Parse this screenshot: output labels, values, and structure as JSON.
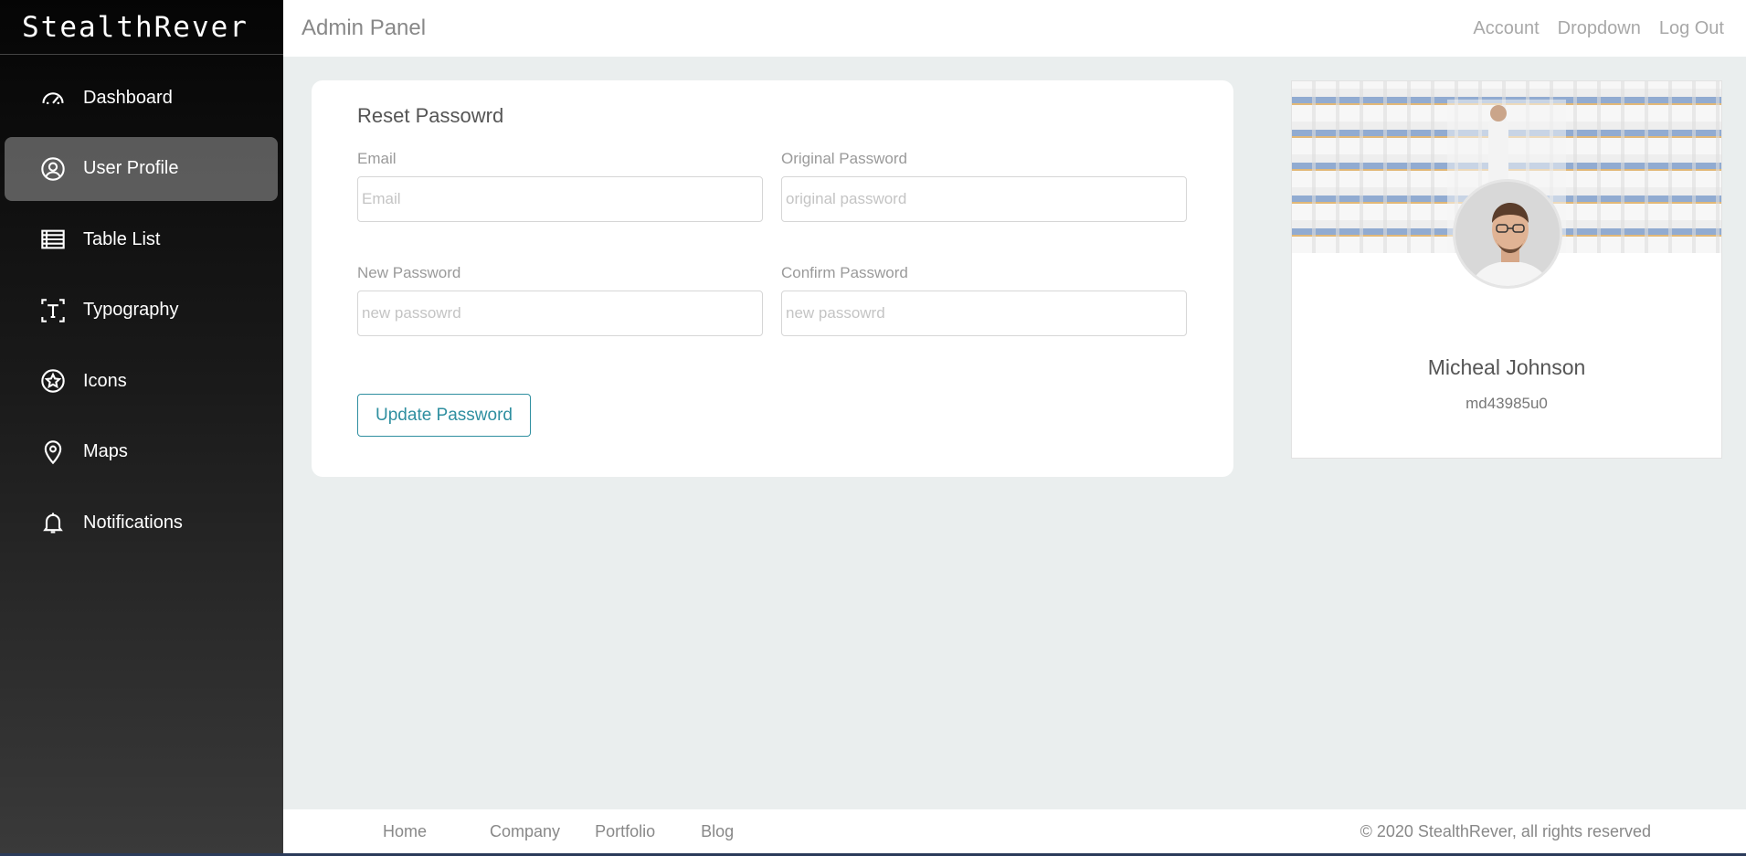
{
  "brand": "StealthRever",
  "sidebar": {
    "items": [
      {
        "label": "Dashboard",
        "icon": "speedometer-icon",
        "active": false
      },
      {
        "label": "User Profile",
        "icon": "user-circle-icon",
        "active": true
      },
      {
        "label": "Table List",
        "icon": "list-icon",
        "active": false
      },
      {
        "label": "Typography",
        "icon": "text-icon",
        "active": false
      },
      {
        "label": "Icons",
        "icon": "star-badge-icon",
        "active": false
      },
      {
        "label": "Maps",
        "icon": "map-pin-icon",
        "active": false
      },
      {
        "label": "Notifications",
        "icon": "bell-icon",
        "active": false
      }
    ]
  },
  "header": {
    "title": "Admin Panel",
    "links": [
      "Account",
      "Dropdown",
      "Log Out"
    ]
  },
  "form": {
    "title": "Reset Passowrd",
    "email": {
      "label": "Email",
      "placeholder": "Email",
      "value": ""
    },
    "original_password": {
      "label": "Original Password",
      "placeholder": "original password",
      "value": ""
    },
    "new_password": {
      "label": "New Password",
      "placeholder": "new passowrd",
      "value": ""
    },
    "confirm_password": {
      "label": "Confirm Password",
      "placeholder": "new passowrd",
      "value": ""
    },
    "submit_label": "Update Password"
  },
  "profile": {
    "name": "Micheal Johnson",
    "username": "md43985u0"
  },
  "footer": {
    "links": [
      "Home",
      "Company",
      "Portfolio",
      "Blog"
    ],
    "copyright": "© 2020 StealthRever, all rights reserved"
  },
  "colors": {
    "accent": "#2f8fa0",
    "sidebar_bg": "#1a1a1a",
    "page_bg": "#eaeeee"
  }
}
